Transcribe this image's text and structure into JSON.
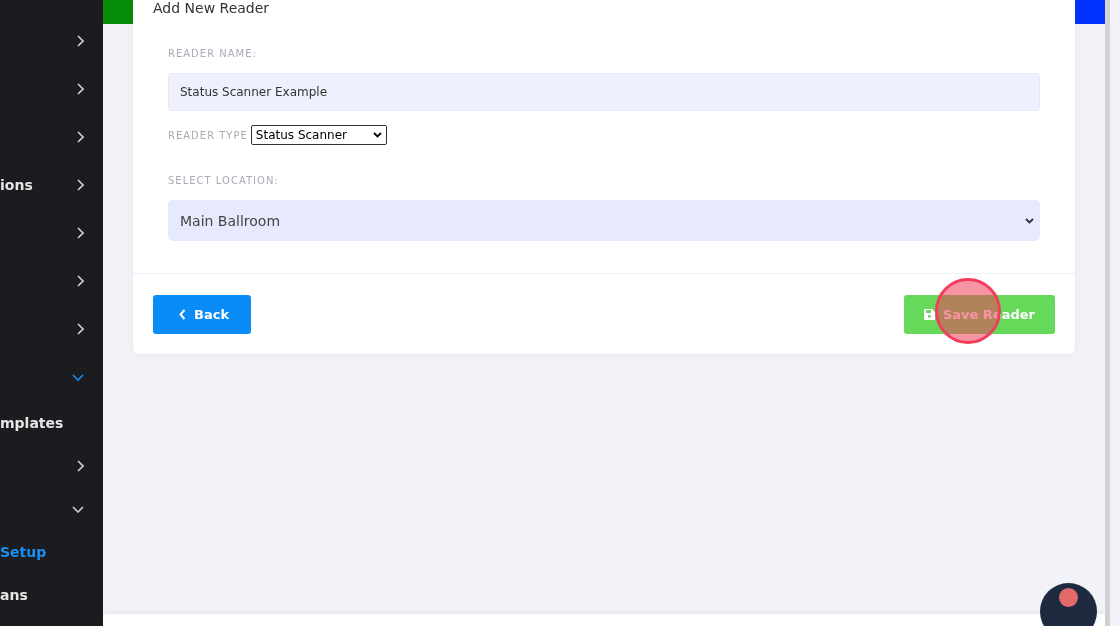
{
  "sidebar": {
    "items": [
      {
        "kind": "group",
        "expanded": false,
        "selected": false
      },
      {
        "kind": "group",
        "expanded": false,
        "selected": false
      },
      {
        "kind": "group",
        "expanded": false,
        "selected": false
      },
      {
        "kind": "group",
        "label": "ions",
        "expanded": false,
        "selected": false
      },
      {
        "kind": "group",
        "expanded": false,
        "selected": false
      },
      {
        "kind": "group",
        "expanded": false,
        "selected": false
      },
      {
        "kind": "group",
        "expanded": false,
        "selected": false
      },
      {
        "kind": "group",
        "expanded": true,
        "selected": true
      },
      {
        "kind": "link",
        "label": "mplates",
        "selected": false
      },
      {
        "kind": "group",
        "expanded": false,
        "selected": false
      },
      {
        "kind": "group",
        "expanded": true,
        "selected": false
      },
      {
        "kind": "link",
        "label": "Setup",
        "selected": true
      },
      {
        "kind": "link",
        "label": "ans",
        "selected": false
      }
    ]
  },
  "card": {
    "title": "Add New Reader",
    "fields": [
      {
        "kind": "text",
        "label": "READER NAME:",
        "value": "Status Scanner Example"
      },
      {
        "kind": "native-select",
        "label": "READER TYPE",
        "value": "Status Scanner"
      },
      {
        "kind": "select",
        "label": "SELECT LOCATION:",
        "value": "Main Ballroom"
      }
    ],
    "back_button": "Back",
    "save_button": "Save Reader"
  }
}
